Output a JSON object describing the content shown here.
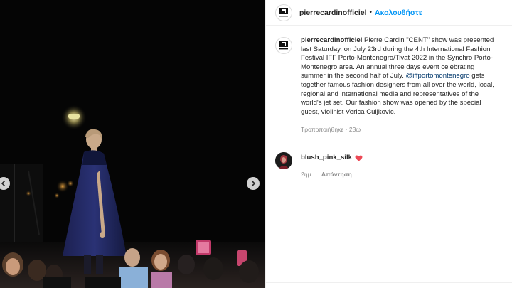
{
  "post": {
    "username": "pierrecardinofficiel",
    "separator": "•",
    "follow_label": "Ακολουθήστε"
  },
  "caption": {
    "username": "pierrecardinofficiel",
    "lines": [
      " Pierre Cardin \"CENT\" show was presented",
      "last Saturday, on July 23rd during the 4th International Fashion",
      "Festival IFF Porto-Montenegro/Tivat 2022 in the Synchro Porto-",
      "Montenegro area. An annual three days event celebrating",
      "summer in the second half of July. "
    ],
    "mention": "@iffportomontenegro",
    "lines_after": [
      " gets",
      "together famous fashion designers from all over the world, local,",
      "regional and international media and representatives of the",
      "world's jet set. Our fashion show was opened by the special",
      "guest, violinist Verica Culjkovic."
    ],
    "meta": "Τροποποιήθηκε · 23ω"
  },
  "comment": {
    "username": "blush_pink_silk",
    "icon": "red-heart",
    "time": "2ημ.",
    "reply_label": "Απάντηση"
  },
  "colors": {
    "link": "#0095f6",
    "mention": "#00376b",
    "heart": "#ed4956",
    "muted": "#8e8e8e"
  }
}
